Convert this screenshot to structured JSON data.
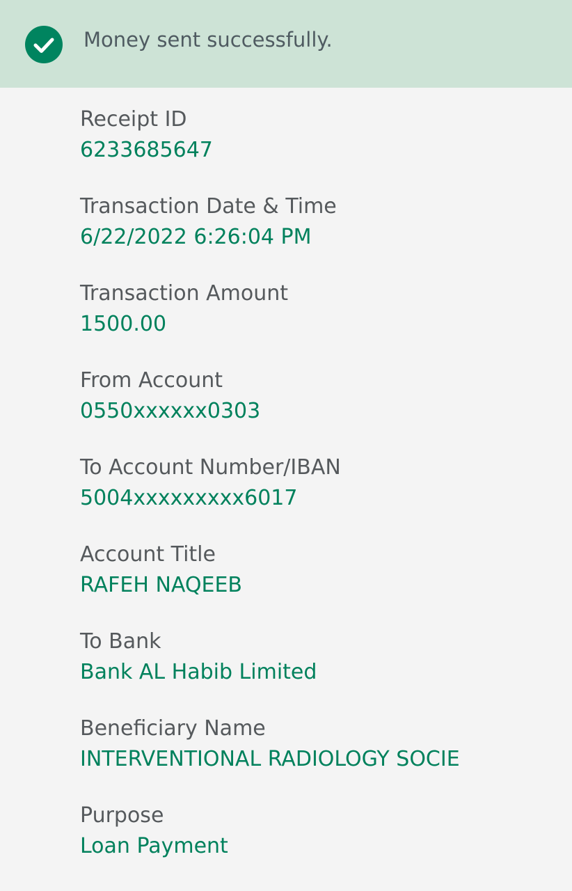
{
  "banner": {
    "icon": "check-circle-icon",
    "message": "Money sent successfully.",
    "background_color": "#cde3d6",
    "icon_color": "#00845f"
  },
  "colors": {
    "label": "#55595c",
    "value": "#00815c",
    "page_background": "#f4f4f4"
  },
  "receipt": {
    "fields": [
      {
        "label": "Receipt ID",
        "value": "6233685647"
      },
      {
        "label": "Transaction Date & Time",
        "value": "6/22/2022 6:26:04 PM"
      },
      {
        "label": "Transaction Amount",
        "value": "1500.00"
      },
      {
        "label": "From Account",
        "value": "0550xxxxxx0303"
      },
      {
        "label": "To Account Number/IBAN",
        "value": "5004xxxxxxxxx6017"
      },
      {
        "label": "Account Title",
        "value": "RAFEH NAQEEB"
      },
      {
        "label": "To Bank",
        "value": "Bank AL Habib Limited"
      },
      {
        "label": "Beneficiary Name",
        "value": "INTERVENTIONAL RADIOLOGY SOCIE"
      },
      {
        "label": "Purpose",
        "value": "Loan Payment"
      }
    ]
  }
}
